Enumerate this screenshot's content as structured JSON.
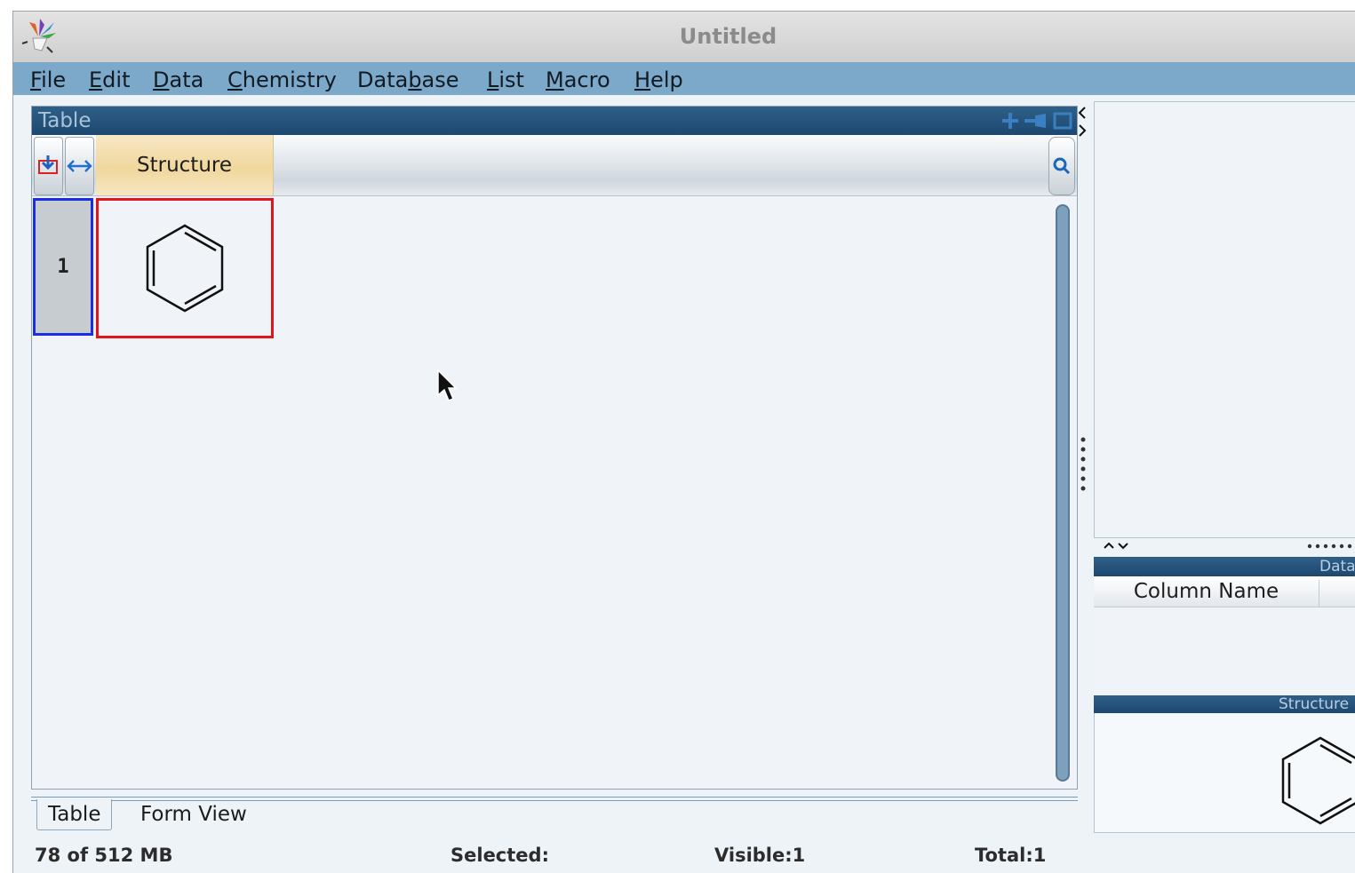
{
  "window": {
    "title": "Untitled"
  },
  "menubar": {
    "items": [
      {
        "pre": "",
        "mnemonic": "F",
        "post": "ile"
      },
      {
        "pre": "",
        "mnemonic": "E",
        "post": "dit"
      },
      {
        "pre": "",
        "mnemonic": "D",
        "post": "ata"
      },
      {
        "pre": "",
        "mnemonic": "C",
        "post": "hemistry"
      },
      {
        "pre": "Data",
        "mnemonic": "b",
        "post": "ase"
      },
      {
        "pre": "",
        "mnemonic": "L",
        "post": "ist"
      },
      {
        "pre": "",
        "mnemonic": "M",
        "post": "acro"
      },
      {
        "pre": "",
        "mnemonic": "H",
        "post": "elp"
      }
    ]
  },
  "table_pane": {
    "title": "Table",
    "column_header": "Structure",
    "rows": [
      {
        "number": "1",
        "structure": "benzene-ring"
      }
    ]
  },
  "bottom_tabs": {
    "table": "Table",
    "form_view": "Form View"
  },
  "status": {
    "memory": "78 of 512 MB",
    "selected": "Selected:",
    "visible": "Visible:1",
    "total": "Total:1"
  },
  "right_panel": {
    "data_header": "Data",
    "column_name": "Column Name",
    "structure_header": "Structure"
  },
  "colors": {
    "menubar": "#7ca8ca",
    "pane_header": "#1d4870",
    "row_selection": "#1a2de6",
    "cell_selection": "#e3151a",
    "column_header": "#f0d79c"
  }
}
